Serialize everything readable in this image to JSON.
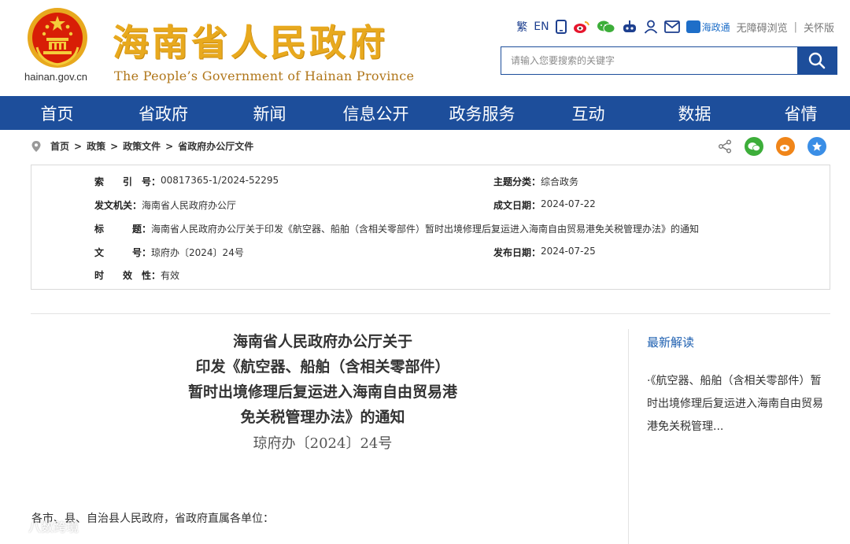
{
  "header": {
    "domain": "hainan.gov.cn",
    "title": "海南省人民政府",
    "subtitle": "The People’s Government  of Hainan Province"
  },
  "topbar": {
    "traditional": "繁",
    "english": "EN",
    "icons": [
      "mobile-icon",
      "weibo-icon",
      "wechat-icon",
      "robot-icon",
      "user-icon",
      "mail-icon"
    ],
    "hainantong": "海政通",
    "accessible": "无障碍浏览",
    "sep": "|",
    "elderly": "关怀版"
  },
  "search": {
    "placeholder": "请输入您要搜索的关键字"
  },
  "nav": {
    "items": [
      "首页",
      "省政府",
      "新闻",
      "信息公开",
      "政务服务",
      "互动",
      "数据",
      "省情"
    ]
  },
  "breadcrumb": {
    "items": [
      "首页",
      "政策",
      "政策文件",
      "省政府办公厅文件"
    ],
    "sep": ">"
  },
  "meta": {
    "index_label": "索　　引　号：",
    "index_value": "00817365-1/2024-52295",
    "topic_label": "主题分类：",
    "topic_value": "综合政务",
    "issuer_label": "发文机关：",
    "issuer_value": "海南省人民政府办公厅",
    "date_label": "成文日期：",
    "date_value": "2024-07-22",
    "title_label": "标　　　题：",
    "title_value": "海南省人民政府办公厅关于印发《航空器、船舶（含相关零部件）暂时出境修理后复运进入海南自由贸易港免关税管理办法》的通知",
    "docno_label": "文　　　号：",
    "docno_value": "琼府办〔2024〕24号",
    "pubdate_label": "发布日期：",
    "pubdate_value": "2024-07-25",
    "validity_label": "时　　效　性：",
    "validity_value": "有效"
  },
  "article": {
    "title_lines": [
      "海南省人民政府办公厅关于",
      "印发《航空器、船舶（含相关零部件）",
      "暂时出境修理后复运进入海南自由贸易港",
      "免关税管理办法》的通知"
    ],
    "doc_number": "琼府办〔2024〕24号",
    "salutation": "各市、县、自治县人民政府，省政府直属各单位："
  },
  "sidebar": {
    "title": "最新解读",
    "link": "·《航空器、船舶（含相关零部件）暂时出境修理后复运进入海南自由贸易港免关税管理..."
  },
  "watermark": "八数跨境",
  "colors": {
    "brand_blue": "#1d4e9b",
    "title_gold": "#e8a91e",
    "emblem_red": "#d81e06",
    "link_blue": "#1d5fb0"
  }
}
